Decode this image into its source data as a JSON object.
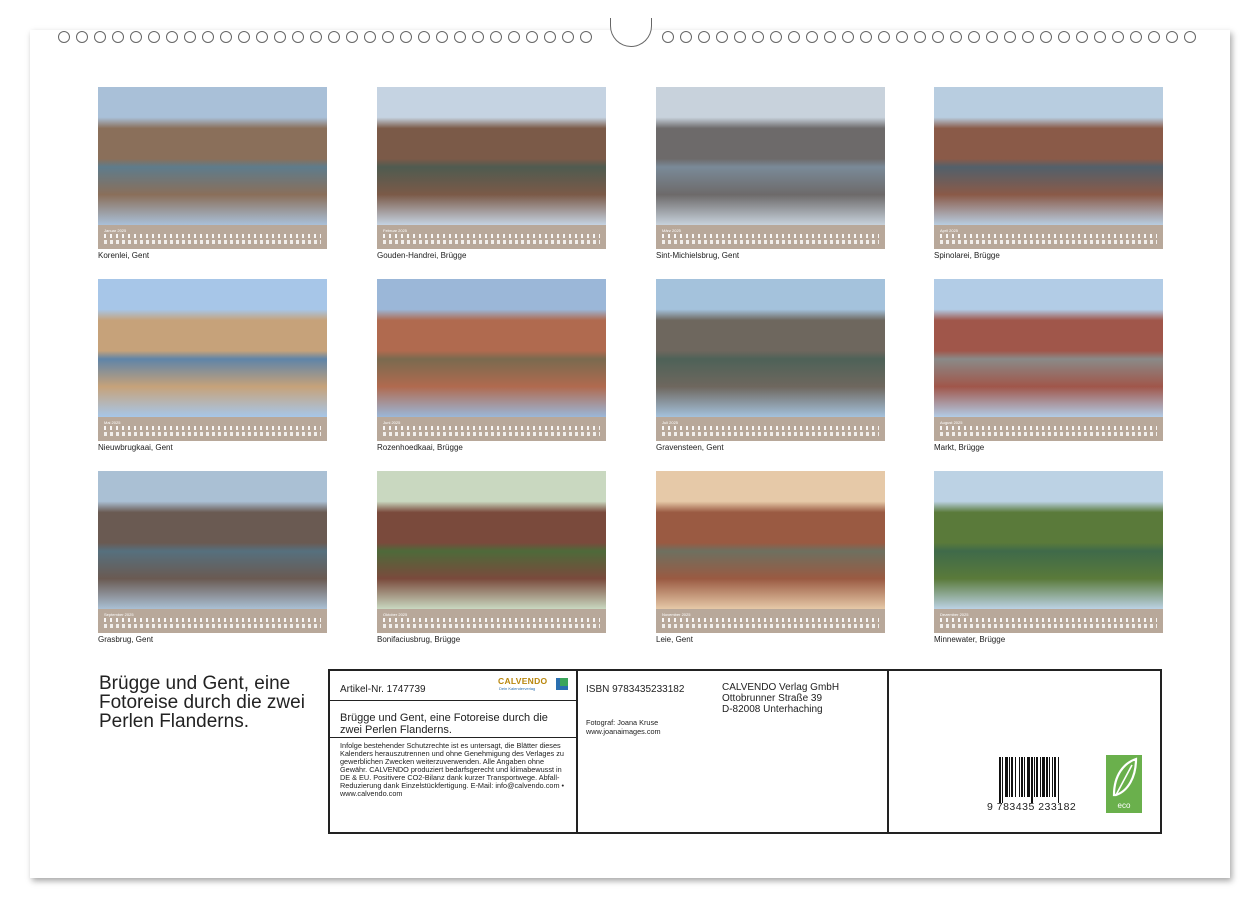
{
  "months": [
    {
      "label": "Januar 2025",
      "caption": "Korenlei, Gent"
    },
    {
      "label": "Februar 2025",
      "caption": "Gouden-Handrei, Brügge"
    },
    {
      "label": "März 2025",
      "caption": "Sint-Michielsbrug, Gent"
    },
    {
      "label": "April 2025",
      "caption": "Spinolarei, Brügge"
    },
    {
      "label": "Mai 2025",
      "caption": "Nieuwbrugkaai, Gent"
    },
    {
      "label": "Juni 2025",
      "caption": "Rozenhoedkaai, Brügge"
    },
    {
      "label": "Juli 2025",
      "caption": "Gravensteen, Gent"
    },
    {
      "label": "August 2025",
      "caption": "Markt, Brügge"
    },
    {
      "label": "September 2025",
      "caption": "Grasbrug, Gent"
    },
    {
      "label": "Oktober 2025",
      "caption": "Bonifaciusbrug, Brügge"
    },
    {
      "label": "November 2025",
      "caption": "Leie, Gent"
    },
    {
      "label": "Dezember 2025",
      "caption": "Minnewater, Brügge"
    }
  ],
  "title": "Brügge und Gent, eine Fotoreise durch die zwei Perlen Flanderns.",
  "info": {
    "article": "Artikel-Nr. 1747739",
    "brand": "CALVENDO",
    "brand_sub": "Dein Kalenderverlag",
    "description": "Brügge und Gent, eine Fotoreise durch die zwei Perlen Flanderns.",
    "legal": "Infolge bestehender Schutzrechte ist es untersagt, die Blätter dieses Kalenders herauszutrennen und ohne Genehmigung des Verlages zu gewerblichen Zwecken weiterzuverwenden. Alle Angaben ohne Gewähr. CALVENDO produziert bedarfsgerecht und klimabewusst in DE & EU. Positivere CO2-Bilanz dank kurzer Transportwege. Abfall-Reduzierung dank Einzelstückfertigung. E-Mail: info@calvendo.com • www.calvendo.com",
    "isbn": "ISBN 9783435233182",
    "photographer": "Fotograf: Joana Kruse",
    "website": "www.joanaimages.com",
    "publisher_name": "CALVENDO Verlag GmbH",
    "publisher_street": "Ottobrunner Straße 39",
    "publisher_city": "D-82008 Unterhaching",
    "barcode_number": "9 783435 233182",
    "eco_label": "eco"
  },
  "colors": {
    "calendar_strip": "#b8a89a",
    "eco_green": "#6ab04c"
  }
}
